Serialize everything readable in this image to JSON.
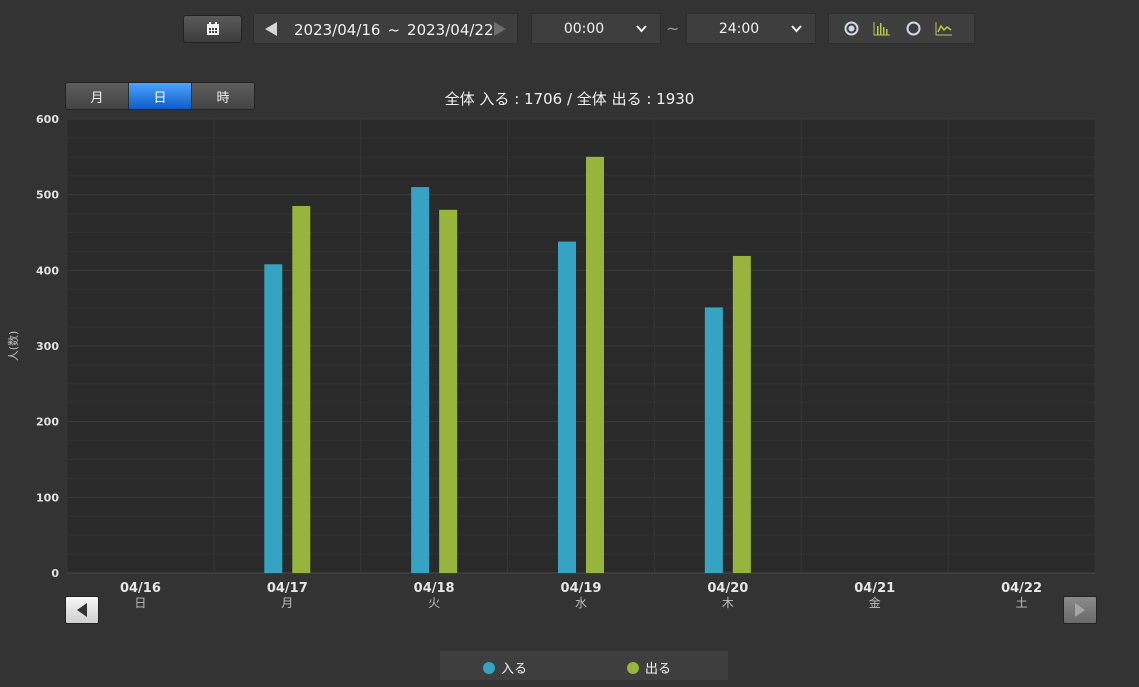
{
  "toolbar": {
    "calendar_icon": "calendar-icon",
    "date_range": {
      "start": "2023/04/16",
      "separator": "~",
      "end": "2023/04/22"
    },
    "time_from": "00:00",
    "time_to": "24:00",
    "time_separator": "~",
    "modes": [
      "radio-selected-icon",
      "bar-chart-icon",
      "radio-empty-icon",
      "line-chart-icon"
    ]
  },
  "tabs": [
    {
      "label": "月",
      "active": false
    },
    {
      "label": "日",
      "active": true
    },
    {
      "label": "時",
      "active": false
    }
  ],
  "summary": {
    "in_label": "全体 入る : ",
    "in_value": "1706",
    "divider": " / ",
    "out_label": "全体 出る : ",
    "out_value": "1930"
  },
  "chart_data": {
    "type": "bar",
    "title": "",
    "xlabel": "",
    "ylabel": "人(数)",
    "ylim": [
      0,
      600
    ],
    "yticks": [
      0,
      100,
      200,
      300,
      400,
      500,
      600
    ],
    "grid": true,
    "categories": [
      "04/16",
      "04/17",
      "04/18",
      "04/19",
      "04/20",
      "04/21",
      "04/22"
    ],
    "weekdays": [
      "日",
      "月",
      "火",
      "水",
      "木",
      "金",
      "土"
    ],
    "series": [
      {
        "name": "入る",
        "color": "#35a3c2",
        "values": [
          0,
          408,
          510,
          438,
          351,
          0,
          0
        ]
      },
      {
        "name": "出る",
        "color": "#97b53c",
        "values": [
          0,
          485,
          480,
          550,
          419,
          0,
          0
        ]
      }
    ],
    "legend_position": "bottom"
  },
  "colors": {
    "background": "#333333",
    "plot_background": "#2a2a2a",
    "accent_blue": "#1a6fd8",
    "series_in": "#35a3c2",
    "series_out": "#97b53c"
  }
}
